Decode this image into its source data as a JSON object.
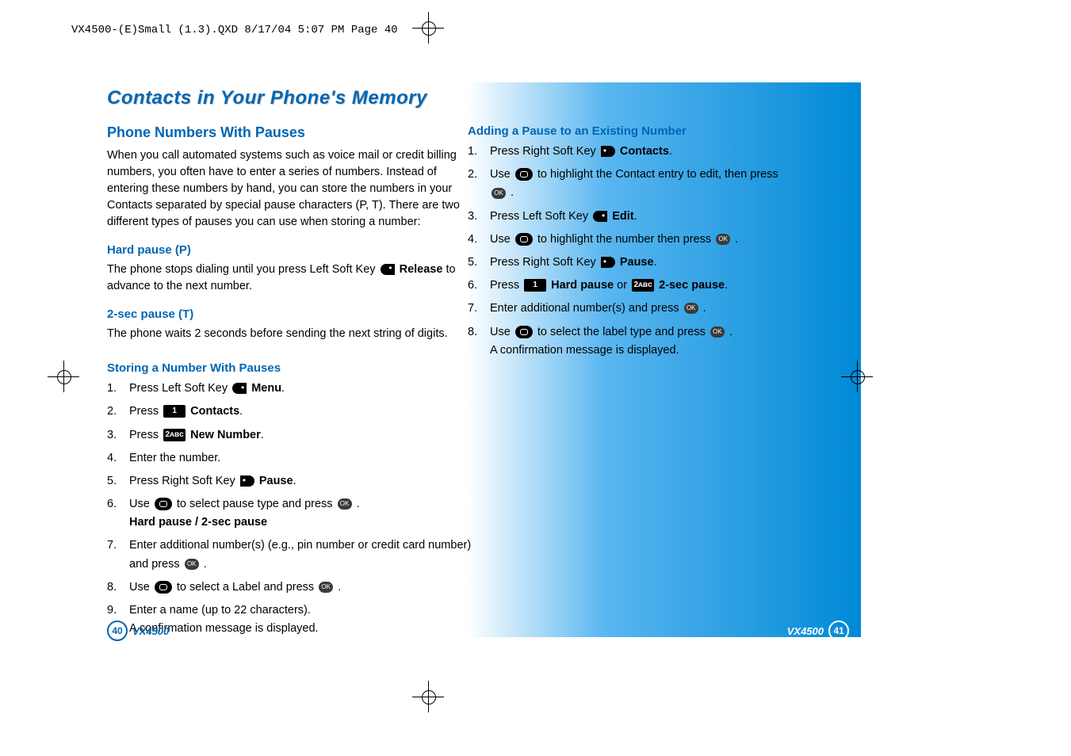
{
  "header_line": "VX4500-(E)Small (1.3).QXD  8/17/04  5:07 PM  Page 40",
  "section_title": "Contacts in Your Phone's Memory",
  "left": {
    "h2": "Phone Numbers With Pauses",
    "intro": "When you call automated systems such as voice mail or credit billing numbers, you often have to enter a series of numbers. Instead of entering these numbers by hand, you can store the numbers in your Contacts separated by special pause characters (P, T). There are two different types of pauses you can use when storing a number:",
    "hardpause_h": "Hard pause (P)",
    "hardpause_t1": "The phone stops dialing until you press Left Soft Key ",
    "hardpause_bold": "Release",
    "hardpause_t2": " to advance to the next number.",
    "twosec_h": "2-sec pause (T)",
    "twosec_t": "The phone waits 2 seconds before sending the next string of digits.",
    "storing_h": "Storing a Number With Pauses",
    "steps": {
      "s1a": "Press Left Soft Key ",
      "s1b": "Menu",
      "s1c": ".",
      "s2a": "Press ",
      "s2b": "Contacts",
      "s2c": ".",
      "s3a": "Press ",
      "s3b": "New Number",
      "s3c": ".",
      "s4": "Enter the number.",
      "s5a": "Press Right Soft Key ",
      "s5b": "Pause",
      "s5c": ".",
      "s6a": "Use ",
      "s6b": " to select pause type and press ",
      "s6c": " .",
      "s6d": "Hard pause / 2-sec pause",
      "s7a": "Enter additional number(s) (e.g., pin number or credit card number) and press ",
      "s7b": " .",
      "s8a": "Use ",
      "s8b": " to select a Label and press ",
      "s8c": " .",
      "s9a": "Enter a name (up to 22 characters).",
      "s9b": "A confirmation message is displayed."
    },
    "key1": "1",
    "key2": "2ᴀʙᴄ"
  },
  "right": {
    "h3": "Adding a Pause to an Existing Number",
    "steps": {
      "r1a": "Press Right Soft Key ",
      "r1b": "Contacts",
      "r1c": ".",
      "r2a": "Use ",
      "r2b": " to highlight the Contact entry to edit, then press ",
      "r2c": " .",
      "r3a": "Press Left Soft Key ",
      "r3b": "Edit",
      "r3c": ".",
      "r4a": "Use ",
      "r4b": " to highlight the number then press ",
      "r4c": " .",
      "r5a": "Press Right Soft Key ",
      "r5b": "Pause",
      "r5c": ".",
      "r6a": "Press ",
      "r6b": "Hard pause",
      "r6c": " or ",
      "r6d": "2-sec pause",
      "r6e": ".",
      "r7a": "Enter additional number(s) and press ",
      "r7b": " .",
      "r8a": "Use ",
      "r8b": " to select the label type and press ",
      "r8c": " .",
      "r8d": "A confirmation message is displayed."
    },
    "key1": "1",
    "key2": "2ᴀʙᴄ"
  },
  "footer": {
    "page_left": "40",
    "page_right": "41",
    "model": "VX4500"
  }
}
